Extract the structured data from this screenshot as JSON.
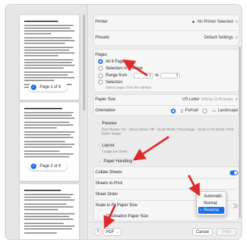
{
  "thumbnails": [
    {
      "label": "Page 1 of 6"
    },
    {
      "label": "Page 2 of 6"
    }
  ],
  "printer": {
    "label": "Printer",
    "value": "No Printer Selected"
  },
  "presets": {
    "label": "Presets",
    "value": "Default Settings"
  },
  "pages": {
    "title": "Pages",
    "options": [
      "All 6 Pages",
      "Selection in Preview",
      "Range from",
      "Selection"
    ],
    "range_from": "1",
    "range_to_label": "to",
    "range_to": "1",
    "selection_sub": "Select pages from the sidebar"
  },
  "paper_size": {
    "label": "Paper Size",
    "value": "US Letter",
    "sub": "8.50 by 11.00 inches"
  },
  "orientation": {
    "label": "Orientation",
    "portrait": "Portrait",
    "landscape": "Landscape"
  },
  "preview": {
    "label": "Preview",
    "sub": "Auto Rotate: On - Show Notes: Off - Scale Mode: Percentage - Scale to Fit Mode: Print Entire Image"
  },
  "layout": {
    "label": "Layout",
    "sub": "1 page per sheet"
  },
  "paper_handling": {
    "label": "Paper Handling",
    "collate": "Collate Sheets",
    "sheets_to_print": "Sheets to Print",
    "sheet_order": "Sheet Order",
    "scale_to_fit": "Scale to Fit Paper Size",
    "destination": "Destination Paper Size"
  },
  "sheet_order_menu": {
    "options": [
      "Automatic",
      "Normal",
      "Reverse"
    ],
    "selected": "Reverse"
  },
  "bottom": {
    "help": "?",
    "pdf": "PDF",
    "cancel": "Cancel",
    "print": "Print"
  }
}
